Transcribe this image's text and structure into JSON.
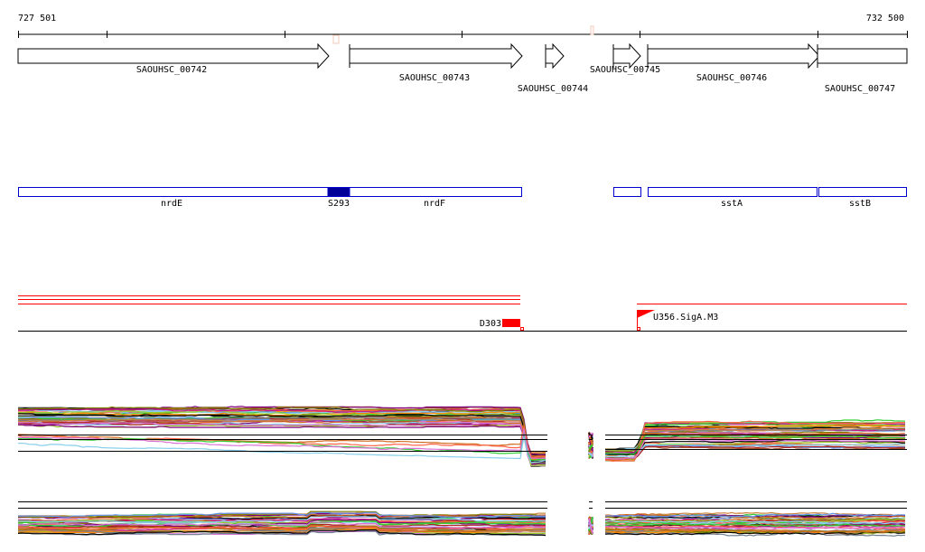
{
  "ruler": {
    "start_label": "727 501",
    "end_label": "732 500"
  },
  "genes": [
    {
      "label": "SAOUHSC_00742",
      "strand": "+"
    },
    {
      "label": "SAOUHSC_00743",
      "strand": "+"
    },
    {
      "label": "SAOUHSC_00744",
      "strand": "+"
    },
    {
      "label": "SAOUHSC_00745",
      "strand": "+"
    },
    {
      "label": "SAOUHSC_00746",
      "strand": "+"
    },
    {
      "label": "SAOUHSC_00747",
      "strand": "+"
    }
  ],
  "annotations": [
    {
      "label": "nrdE"
    },
    {
      "label": "S293"
    },
    {
      "label": "nrdF"
    },
    {
      "label": "sstA"
    },
    {
      "label": "sstB"
    }
  ],
  "features": {
    "left_label": "D303",
    "right_label": "U356.SigA.M3"
  },
  "colors": {
    "annotation": "#0000cc",
    "annotation_fill": "#000099",
    "feature": "#ff0000",
    "marker": "#f4c9b8",
    "traces": [
      "#000000",
      "#800080",
      "#808000",
      "#d2691e",
      "#ff6347",
      "#32cd32",
      "#87ceeb",
      "#da70d6",
      "#a0522d",
      "#ff8c00",
      "#6495ed",
      "#b22222",
      "#9acd32",
      "#c71585",
      "#708090",
      "#cd853f"
    ]
  }
}
